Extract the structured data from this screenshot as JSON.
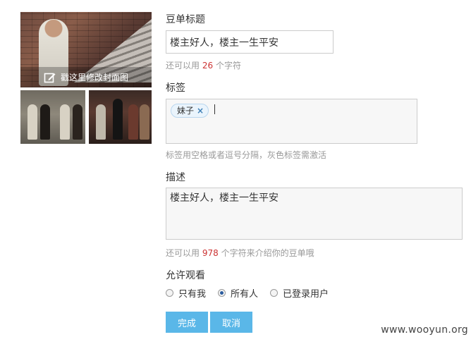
{
  "cover": {
    "edit_label": "戳这里修改封面图"
  },
  "form": {
    "title_label": "豆单标题",
    "title_value": "楼主好人，楼主一生平安",
    "title_hint_prefix": "还可以用",
    "title_hint_count": "26",
    "title_hint_suffix": "个字符",
    "tags_label": "标签",
    "tags": [
      "妹子"
    ],
    "tag_remove": "×",
    "tags_hint": "标签用空格或者逗号分隔，灰色标签需激活",
    "desc_label": "描述",
    "desc_value": "楼主好人，楼主一生平安",
    "desc_hint_prefix": "还可以用",
    "desc_hint_count": "978",
    "desc_hint_suffix": "个字符来介绍你的豆单哦",
    "visibility_label": "允许观看",
    "visibility_options": [
      {
        "label": "只有我",
        "checked": false
      },
      {
        "label": "所有人",
        "checked": true
      },
      {
        "label": "已登录用户",
        "checked": false
      }
    ],
    "submit_label": "完成",
    "cancel_label": "取消"
  },
  "watermark": "www.wooyun.org",
  "colors": {
    "button": "#5ab7e8",
    "count_highlight": "#cc3333",
    "hint": "#999999"
  }
}
